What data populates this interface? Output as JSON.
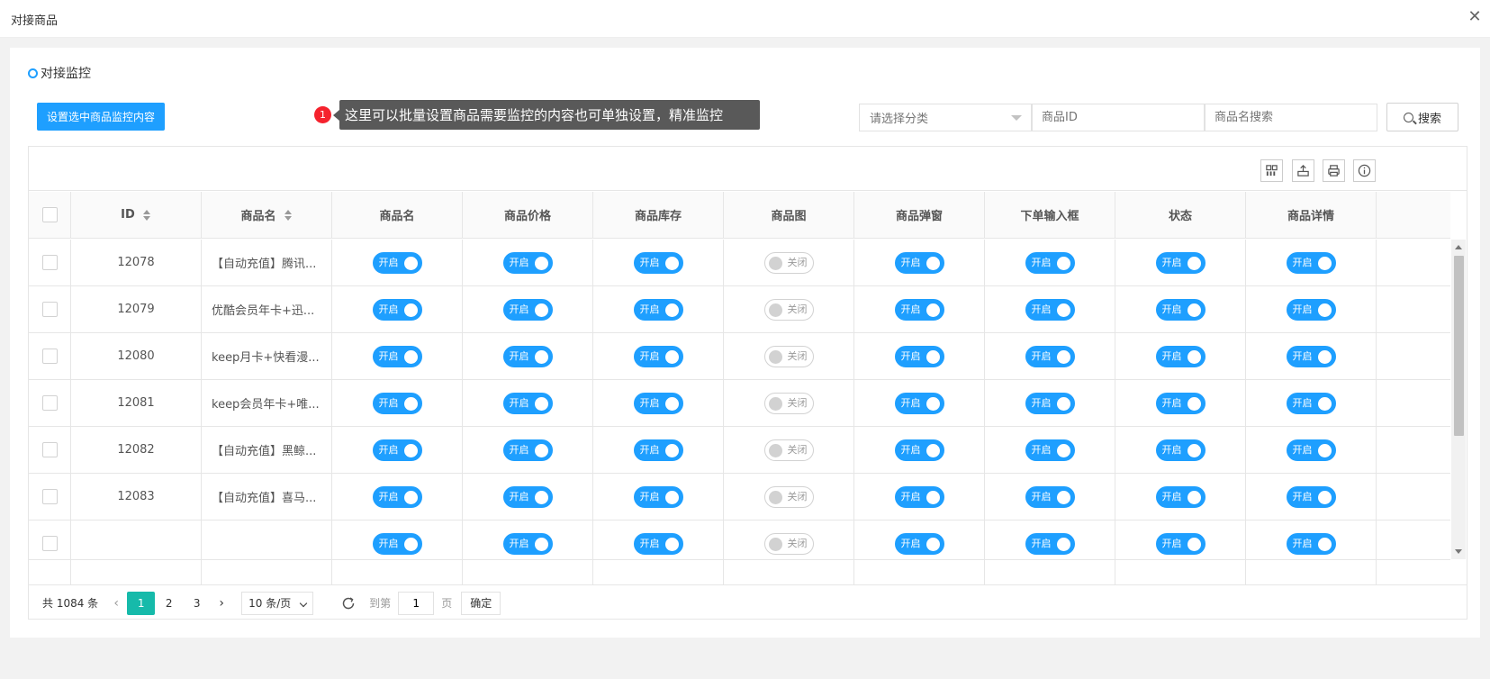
{
  "window": {
    "title": "对接商品",
    "close_icon": "close-icon"
  },
  "section": {
    "title": "对接监控"
  },
  "toolbar": {
    "batch_button": "设置选中商品监控内容",
    "hint_badge": "1",
    "hint_text": "这里可以批量设置商品需要监控的内容也可单独设置，精准监控",
    "category_placeholder": "请选择分类",
    "id_placeholder": "商品ID",
    "name_placeholder": "商品名搜索",
    "search_label": "搜索"
  },
  "table": {
    "headers": [
      "ID",
      "商品名",
      "商品名",
      "商品价格",
      "商品库存",
      "商品图",
      "商品弹窗",
      "下单输入框",
      "状态",
      "商品详情"
    ],
    "on_label": "开启",
    "off_label": "关闭",
    "rows": [
      {
        "id": "12078",
        "name": "【自动充值】腾讯...",
        "switches": [
          true,
          true,
          true,
          false,
          true,
          true,
          true,
          true
        ]
      },
      {
        "id": "12079",
        "name": "优酷会员年卡+迅...",
        "switches": [
          true,
          true,
          true,
          false,
          true,
          true,
          true,
          true
        ]
      },
      {
        "id": "12080",
        "name": "keep月卡+快看漫...",
        "switches": [
          true,
          true,
          true,
          false,
          true,
          true,
          true,
          true
        ]
      },
      {
        "id": "12081",
        "name": "keep会员年卡+唯...",
        "switches": [
          true,
          true,
          true,
          false,
          true,
          true,
          true,
          true
        ]
      },
      {
        "id": "12082",
        "name": "【自动充值】黑鲸...",
        "switches": [
          true,
          true,
          true,
          false,
          true,
          true,
          true,
          true
        ]
      },
      {
        "id": "12083",
        "name": "【自动充值】喜马...",
        "switches": [
          true,
          true,
          true,
          false,
          true,
          true,
          true,
          true
        ]
      }
    ]
  },
  "pagination": {
    "total": "共 1084 条",
    "pages": [
      "1",
      "2",
      "3"
    ],
    "current": "1",
    "limit": "10 条/页",
    "goto_label": "到第",
    "goto_value": "1",
    "page_unit": "页",
    "confirm": "确定"
  },
  "colors": {
    "primary": "#1e9fff",
    "page_active": "#16baaa",
    "hint_bg": "#595959",
    "badge": "#f5222d"
  }
}
